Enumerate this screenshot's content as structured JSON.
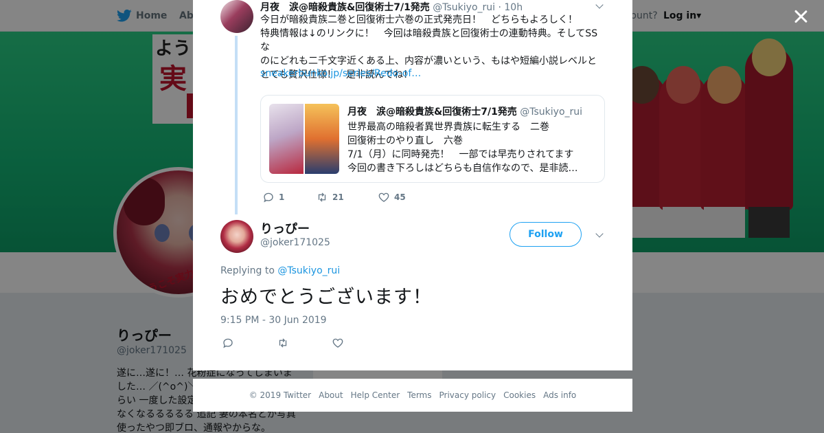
{
  "background": {
    "nav": {
      "home_label": "Home",
      "about_label": "Abo",
      "account_text": "ccount?",
      "login_label": "Log in"
    },
    "banner_text": [
      "よう",
      "実",
      ""
    ],
    "avatar_caption": "ようこそ実力至上",
    "profile": {
      "name": "りっぴー",
      "handle": "@joker171025",
      "bio_lines": [
        "遂に…遂に！… 花粉症になってしまいま",
        "した… ／(^o^)＼",
        "らい 一度した設定",
        "なくなるるるるる 追記 妻の本名とか写真",
        "使ったやつ即ブロ、通報やからな。"
      ]
    }
  },
  "modal": {
    "parent_tweet": {
      "author_name": "月夜　涙@暗殺貴族&回復術士7/1発売",
      "author_handle": "@Tsukiyo_rui",
      "time": "· 10h",
      "text_lines": [
        "今日が暗殺貴族二巻と回復術士六巻の正式発売日！　どちらもよろしく！",
        "特典情報は↓のリンクに！　今回は暗殺貴族と回復術士の連動特典。そしてSSな",
        "のにどれも二千文字近くある上、内容が濃いという、もはや短編小説レベルと",
        "とても贅沢仕様！　是非読んでね！"
      ],
      "link": "sneakerbunko.jp/series/Redo-of…",
      "quote": {
        "author_name": "月夜　涙@暗殺貴族&回復術士7/1発売",
        "author_handle": "@Tsukiyo_rui",
        "lines": [
          "世界最高の暗殺者異世界貴族に転生する　二巻",
          "回復術士のやり直し　六巻",
          "7/1（月）に同時発売！　一部では早売りされてます",
          "今回の書き下ろしはどちらも自信作なので、是非読…"
        ]
      },
      "reply_count": "1",
      "retweet_count": "21",
      "like_count": "45"
    },
    "reply": {
      "author_name": "りっぴー",
      "author_handle": "@joker171025",
      "follow_label": "Follow",
      "replying_prefix": "Replying to",
      "replying_to": "@Tsukiyo_rui",
      "text": "おめでとうございます！",
      "timestamp": "9:15 PM - 30 Jun 2019"
    }
  },
  "footer": {
    "links": [
      "© 2019 Twitter",
      "About",
      "Help Center",
      "Terms",
      "Privacy policy",
      "Cookies",
      "Ads info"
    ]
  },
  "colors": {
    "accent": "#1da1f2",
    "link": "#1b95e0",
    "muted": "#657786",
    "thread_line": "#c4dff6"
  }
}
